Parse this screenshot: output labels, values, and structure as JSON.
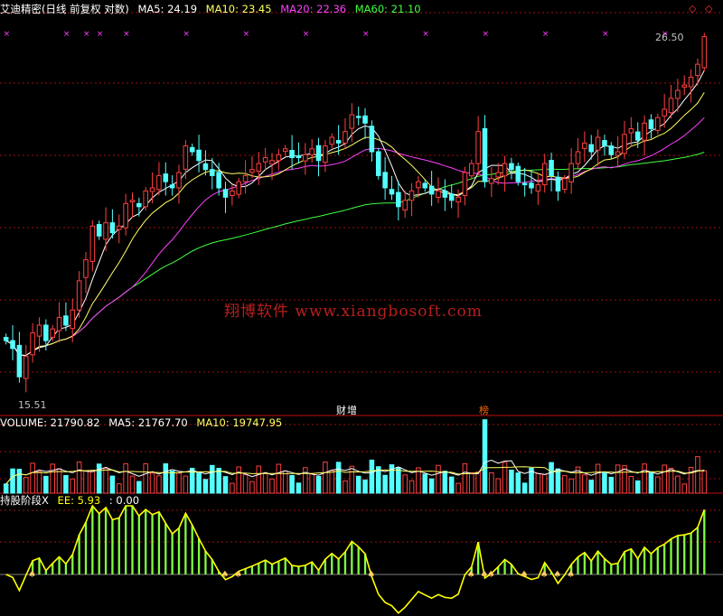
{
  "header": {
    "title": "艾迪精密(日线 前复权 对数)",
    "ma5": "MA5: 24.19",
    "ma10": "MA10: 23.45",
    "ma20": "MA20: 22.36",
    "ma60": "MA60: 21.10"
  },
  "volume_header": {
    "volume": "VOLUME: 21790.82",
    "ma5": "MA5: 21767.70",
    "ma10": "MA10: 19747.95"
  },
  "indicator_header": {
    "name": "持股阶段X",
    "ee": "EE: 5.93",
    "zero": ": 0.00"
  },
  "annotations": {
    "high": "26.50",
    "low": "15.51",
    "event1": "财",
    "event2": "增",
    "event3": "榜"
  },
  "watermark": "翔博软件 www.xiangbosoft.com",
  "colors": {
    "up": "#ff4040",
    "down": "#54ffff",
    "ma5": "#ffffff",
    "ma10": "#ffff60",
    "ma20": "#ff40ff",
    "ma60": "#40ff40",
    "ee_line": "#ffff00",
    "ee_bar": "#80ff40",
    "grid": "#a01010"
  },
  "chart_data": {
    "type": "candlestick",
    "scale": "log",
    "ylim": [
      15.0,
      27.5
    ],
    "close": [
      16.6,
      16.4,
      15.7,
      16.2,
      16.8,
      17.0,
      16.6,
      16.9,
      17.2,
      17.0,
      17.4,
      18.2,
      18.8,
      19.8,
      19.5,
      19.9,
      19.6,
      19.8,
      20.5,
      20.6,
      20.4,
      20.9,
      21.0,
      21.4,
      21.2,
      21.0,
      21.5,
      22.4,
      22.2,
      21.9,
      21.6,
      21.4,
      21.0,
      20.7,
      20.9,
      21.2,
      21.4,
      21.6,
      21.8,
      22.0,
      21.9,
      22.1,
      22.3,
      22.0,
      22.0,
      22.1,
      22.3,
      21.9,
      22.4,
      22.7,
      22.5,
      22.9,
      23.5,
      23.4,
      23.2,
      22.2,
      21.4,
      21.0,
      20.8,
      20.4,
      20.6,
      20.9,
      21.2,
      21.0,
      20.8,
      20.9,
      20.7,
      20.6,
      20.7,
      21.5,
      21.8,
      22.9,
      21.2,
      21.3,
      21.5,
      21.8,
      21.6,
      21.2,
      21.1,
      21.0,
      21.1,
      21.8,
      21.4,
      20.9,
      21.3,
      21.8,
      22.2,
      22.5,
      22.2,
      22.7,
      22.4,
      22.1,
      22.2,
      22.8,
      23.0,
      22.6,
      23.2,
      23.0,
      23.4,
      23.7,
      24.1,
      24.4,
      24.6,
      24.9,
      25.4,
      26.5
    ],
    "volume_range": [
      0,
      60000
    ],
    "ee_range": [
      -5,
      8
    ]
  }
}
